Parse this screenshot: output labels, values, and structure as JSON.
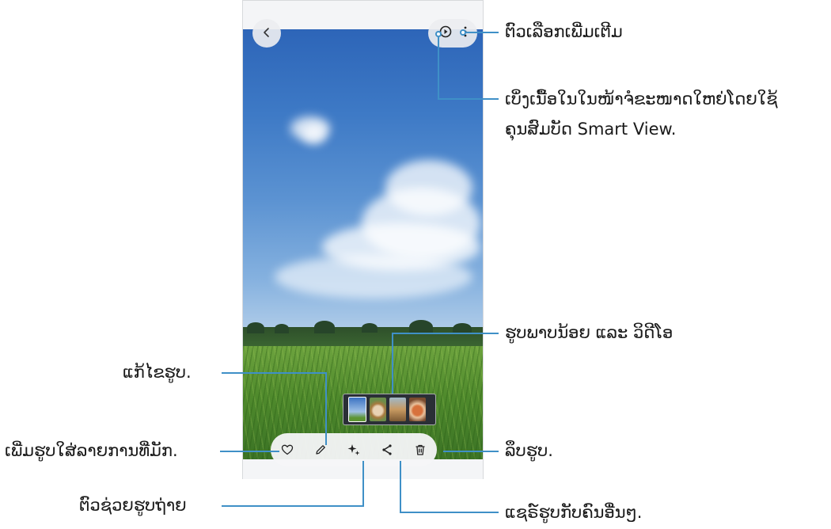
{
  "callouts": {
    "more_options": "ຕົວເລືອກເພີ່ມເຕີມ",
    "smart_view_line1": "ເບິ່ງເນື້ອໃນໃນໜ້າຈໍຂະໜາດໃຫຍ່ໂດຍໃຊ້",
    "smart_view_line2": "ຄຸນສົມບັດ Smart View.",
    "thumbnails": "ຮູບພາບນ້ອຍ ແລະ ວິດີໂອ",
    "edit": "ແກ້ໄຂຮູບ.",
    "favorite": "ເພີ່ມຮູບໃສ່ລາຍການທີ່ມັກ.",
    "delete": "ລຶບຮູບ.",
    "assistant": "ຕົວຊ່ວຍຮູບຖ່າຍ",
    "share": "ແຊຣ໌ຮູບກັບຄົນອື່ນໆ."
  },
  "icons": {
    "back": "back-icon",
    "smart_view": "smart-view-icon",
    "more": "more-options-icon",
    "favorite": "heart-icon",
    "edit": "pencil-icon",
    "assistant": "sparkle-icon",
    "share": "share-icon",
    "delete": "trash-icon"
  },
  "colors": {
    "callout_line": "#3f90c7",
    "toolbar_bg": "#f5f6f8"
  }
}
